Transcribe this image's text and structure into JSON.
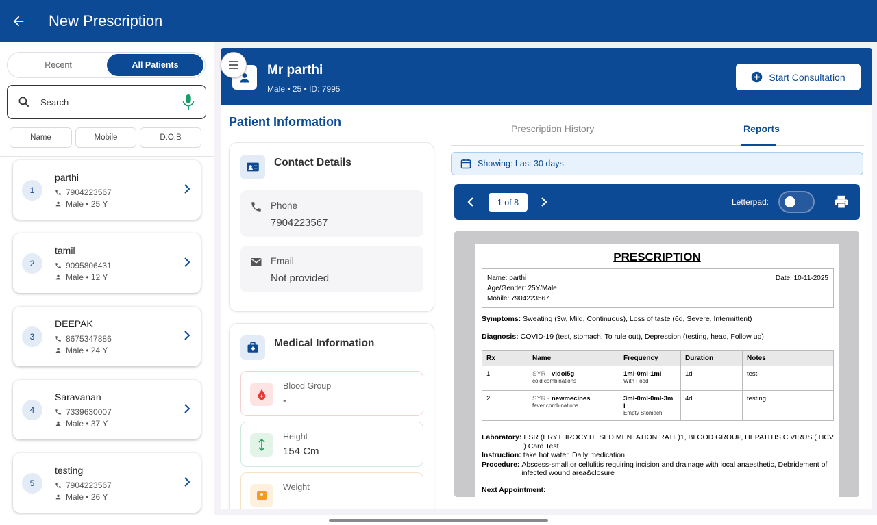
{
  "appbar": {
    "title": "New Prescription"
  },
  "left": {
    "segment": {
      "recent": "Recent",
      "all": "All Patients"
    },
    "search": {
      "placeholder": "Search"
    },
    "filters": [
      "Name",
      "Mobile",
      "D.O.B"
    ],
    "patients": [
      {
        "num": "1",
        "name": "parthi",
        "phone": "7904223567",
        "demo": "Male • 25 Y"
      },
      {
        "num": "2",
        "name": "tamil",
        "phone": "9095806431",
        "demo": "Male • 12 Y"
      },
      {
        "num": "3",
        "name": "DEEPAK",
        "phone": "8675347886",
        "demo": "Male • 24 Y"
      },
      {
        "num": "4",
        "name": "Saravanan",
        "phone": "7339630007",
        "demo": "Male • 37 Y"
      },
      {
        "num": "5",
        "name": "testing",
        "phone": "7904223567",
        "demo": "Male • 26 Y"
      }
    ]
  },
  "header": {
    "name": "Mr parthi",
    "meta": "Male • 25 • ID: 7995",
    "start": "Start Consultation"
  },
  "info": {
    "title": "Patient Information",
    "contact": {
      "title": "Contact Details",
      "phone_label": "Phone",
      "phone_value": "7904223567",
      "email_label": "Email",
      "email_value": "Not provided"
    },
    "medical": {
      "title": "Medical Information",
      "blood_label": "Blood Group",
      "blood_value": "-",
      "height_label": "Height",
      "height_value": "154 Cm",
      "weight_label": "Weight",
      "weight_value": ""
    }
  },
  "tabs": {
    "history": "Prescription History",
    "reports": "Reports"
  },
  "showing": "Showing: Last 30 days",
  "pager": {
    "page": "1 of 8",
    "letterpad": "Letterpad:"
  },
  "doc": {
    "title": "PRESCRIPTION",
    "name": "Name: parthi",
    "age": "Age/Gender: 25Y/Male",
    "mobile": "Mobile: 7904223567",
    "date": "Date: 10-11-2025",
    "symptoms_label": "Symptoms:",
    "symptoms": "Sweating (3w, Mild, Continuous), Loss of taste (6d, Severe, Intermittent)",
    "diagnosis_label": "Diagnosis:",
    "diagnosis": "COVID-19 (test, stomach, To rule out), Depression (testing, head, Follow up)",
    "columns": [
      "Rx",
      "Name",
      "Frequency",
      "Duration",
      "Notes"
    ],
    "rows": [
      {
        "rx": "1",
        "form": "SYR -",
        "drug": "vidol5g",
        "sub": "cold combinations",
        "freq": "1ml-0ml-1ml",
        "freq_sub": "With Food",
        "dur": "1d",
        "notes": "test"
      },
      {
        "rx": "2",
        "form": "SYR -",
        "drug": "newmecines",
        "sub": "fever combinations",
        "freq": "3ml-0ml-0ml-3m l",
        "freq_sub": "Empty Stomach",
        "dur": "4d",
        "notes": "testing"
      }
    ],
    "lab_label": "Laboratory:",
    "lab": "ESR (ERYTHROCYTE SEDIMENTATION RATE)1, BLOOD GROUP, HEPATITIS C VIRUS ( HCV ) Card Test",
    "instr_label": "Instruction:",
    "instr": "take hot water, Daily medication",
    "proc_label": "Procedure:",
    "proc": "Abscess-small,or cellulitis requiring incision and drainage with local anaesthetic, Debridement of infected wound area&closure",
    "next_label": "Next Appointment:"
  },
  "colors": {
    "primary": "#0d4a95",
    "accent_bg": "#e3ebf7"
  }
}
